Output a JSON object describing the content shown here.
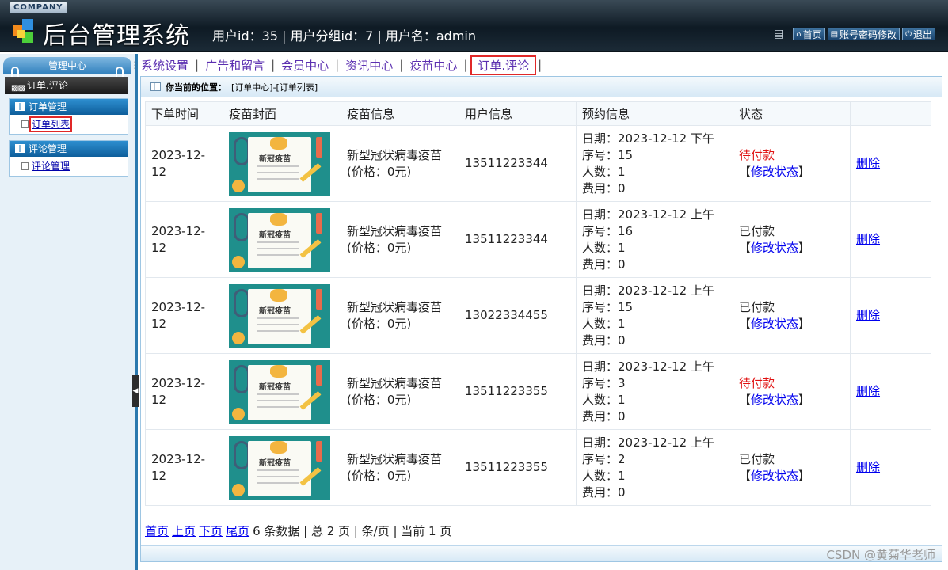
{
  "header": {
    "company": "COMPANY",
    "title": "后台管理系统",
    "user_info": "用户id：35 | 用户分组id：7 | 用户名：admin",
    "links": [
      "首页",
      "账号密码修改",
      "退出"
    ]
  },
  "sidebar": {
    "heading": "管理中心",
    "current_section": "订单.评论",
    "groups": [
      {
        "title": "订单管理",
        "items": [
          {
            "label": "订单列表"
          }
        ]
      },
      {
        "title": "评论管理",
        "items": [
          {
            "label": "评论管理"
          }
        ]
      }
    ]
  },
  "nav": {
    "tabs": [
      "系统设置",
      "广告和留言",
      "会员中心",
      "资讯中心",
      "疫苗中心",
      "订单.评论"
    ],
    "active_index": 5
  },
  "breadcrumb": {
    "label": "你当前的位置：",
    "path": "[订单中心]-[订单列表]"
  },
  "table": {
    "columns": [
      "下单时间",
      "疫苗封面",
      "疫苗信息",
      "用户信息",
      "预约信息",
      "状态",
      ""
    ],
    "cover_title": "新冠疫苗",
    "rows": [
      {
        "order_time_1": "2023-12-",
        "order_time_2": "12",
        "vaccine_name": "新型冠状病毒疫苗",
        "vaccine_price": "(价格：0元)",
        "user_phone": "13511223344",
        "appt_date": "日期：2023-12-12 下午",
        "appt_seq": "序号：15",
        "appt_people": "人数：1",
        "appt_fee": "费用：0",
        "status": "待付款",
        "status_type": "unpaid",
        "modify_label": "修改状态",
        "delete_label": "删除"
      },
      {
        "order_time_1": "2023-12-",
        "order_time_2": "12",
        "vaccine_name": "新型冠状病毒疫苗",
        "vaccine_price": "(价格：0元)",
        "user_phone": "13511223344",
        "appt_date": "日期：2023-12-12 上午",
        "appt_seq": "序号：16",
        "appt_people": "人数：1",
        "appt_fee": "费用：0",
        "status": "已付款",
        "status_type": "paid",
        "modify_label": "修改状态",
        "delete_label": "删除"
      },
      {
        "order_time_1": "2023-12-",
        "order_time_2": "12",
        "vaccine_name": "新型冠状病毒疫苗",
        "vaccine_price": "(价格：0元)",
        "user_phone": "13022334455",
        "appt_date": "日期：2023-12-12 上午",
        "appt_seq": "序号：15",
        "appt_people": "人数：1",
        "appt_fee": "费用：0",
        "status": "已付款",
        "status_type": "paid",
        "modify_label": "修改状态",
        "delete_label": "删除"
      },
      {
        "order_time_1": "2023-12-",
        "order_time_2": "12",
        "vaccine_name": "新型冠状病毒疫苗",
        "vaccine_price": "(价格：0元)",
        "user_phone": "13511223355",
        "appt_date": "日期：2023-12-12 上午",
        "appt_seq": "序号：3",
        "appt_people": "人数：1",
        "appt_fee": "费用：0",
        "status": "待付款",
        "status_type": "unpaid",
        "modify_label": "修改状态",
        "delete_label": "删除"
      },
      {
        "order_time_1": "2023-12-",
        "order_time_2": "12",
        "vaccine_name": "新型冠状病毒疫苗",
        "vaccine_price": "(价格：0元)",
        "user_phone": "13511223355",
        "appt_date": "日期：2023-12-12 上午",
        "appt_seq": "序号：2",
        "appt_people": "人数：1",
        "appt_fee": "费用：0",
        "status": "已付款",
        "status_type": "paid",
        "modify_label": "修改状态",
        "delete_label": "删除"
      }
    ]
  },
  "pager": {
    "links": [
      "首页",
      "上页",
      "下页",
      "尾页"
    ],
    "summary": "6 条数据 | 总 2 页 | 条/页 | 当前 1 页"
  },
  "watermark": "CSDN @黄菊华老师",
  "colors": {
    "unpaid": "#e01010",
    "highlight_border": "#e02828",
    "nav_text": "#5b2fb0"
  }
}
